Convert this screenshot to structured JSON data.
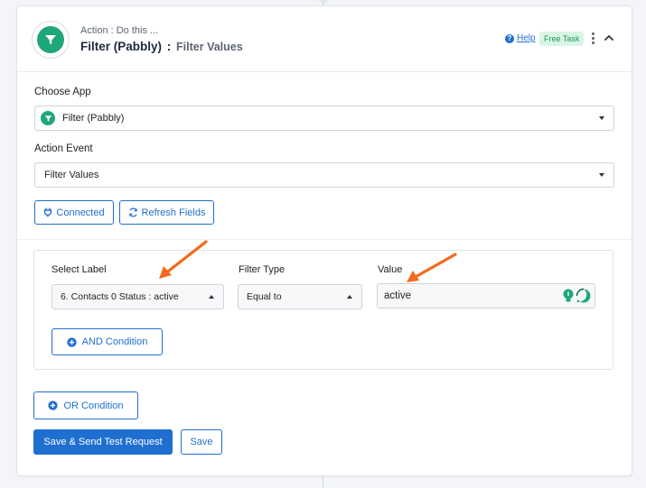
{
  "header": {
    "subtitle": "Action : Do this ...",
    "app_name": "Filter (Pabbly)",
    "separator": ":",
    "event_name": "Filter Values",
    "help_label": "Help",
    "help_icon_glyph": "?",
    "badge_label": "Free Task"
  },
  "form": {
    "choose_app_label": "Choose App",
    "choose_app_value": "Filter (Pabbly)",
    "action_event_label": "Action Event",
    "action_event_value": "Filter Values",
    "connected_label": "Connected",
    "refresh_label": "Refresh Fields"
  },
  "filter": {
    "select_label": "Select Label",
    "select_value": "6. Contacts 0 Status : active",
    "filter_type_label": "Filter Type",
    "filter_type_value": "Equal to",
    "value_label": "Value",
    "value_value": "active",
    "and_condition_label": "AND Condition"
  },
  "footer": {
    "or_condition_label": "OR Condition",
    "save_send_label": "Save & Send Test Request",
    "save_label": "Save"
  },
  "colors": {
    "accent_blue": "#1f6fd1",
    "app_green": "#1fa77a",
    "badge_bg": "#d9f5e6",
    "annotation_orange": "#f26a1b"
  }
}
